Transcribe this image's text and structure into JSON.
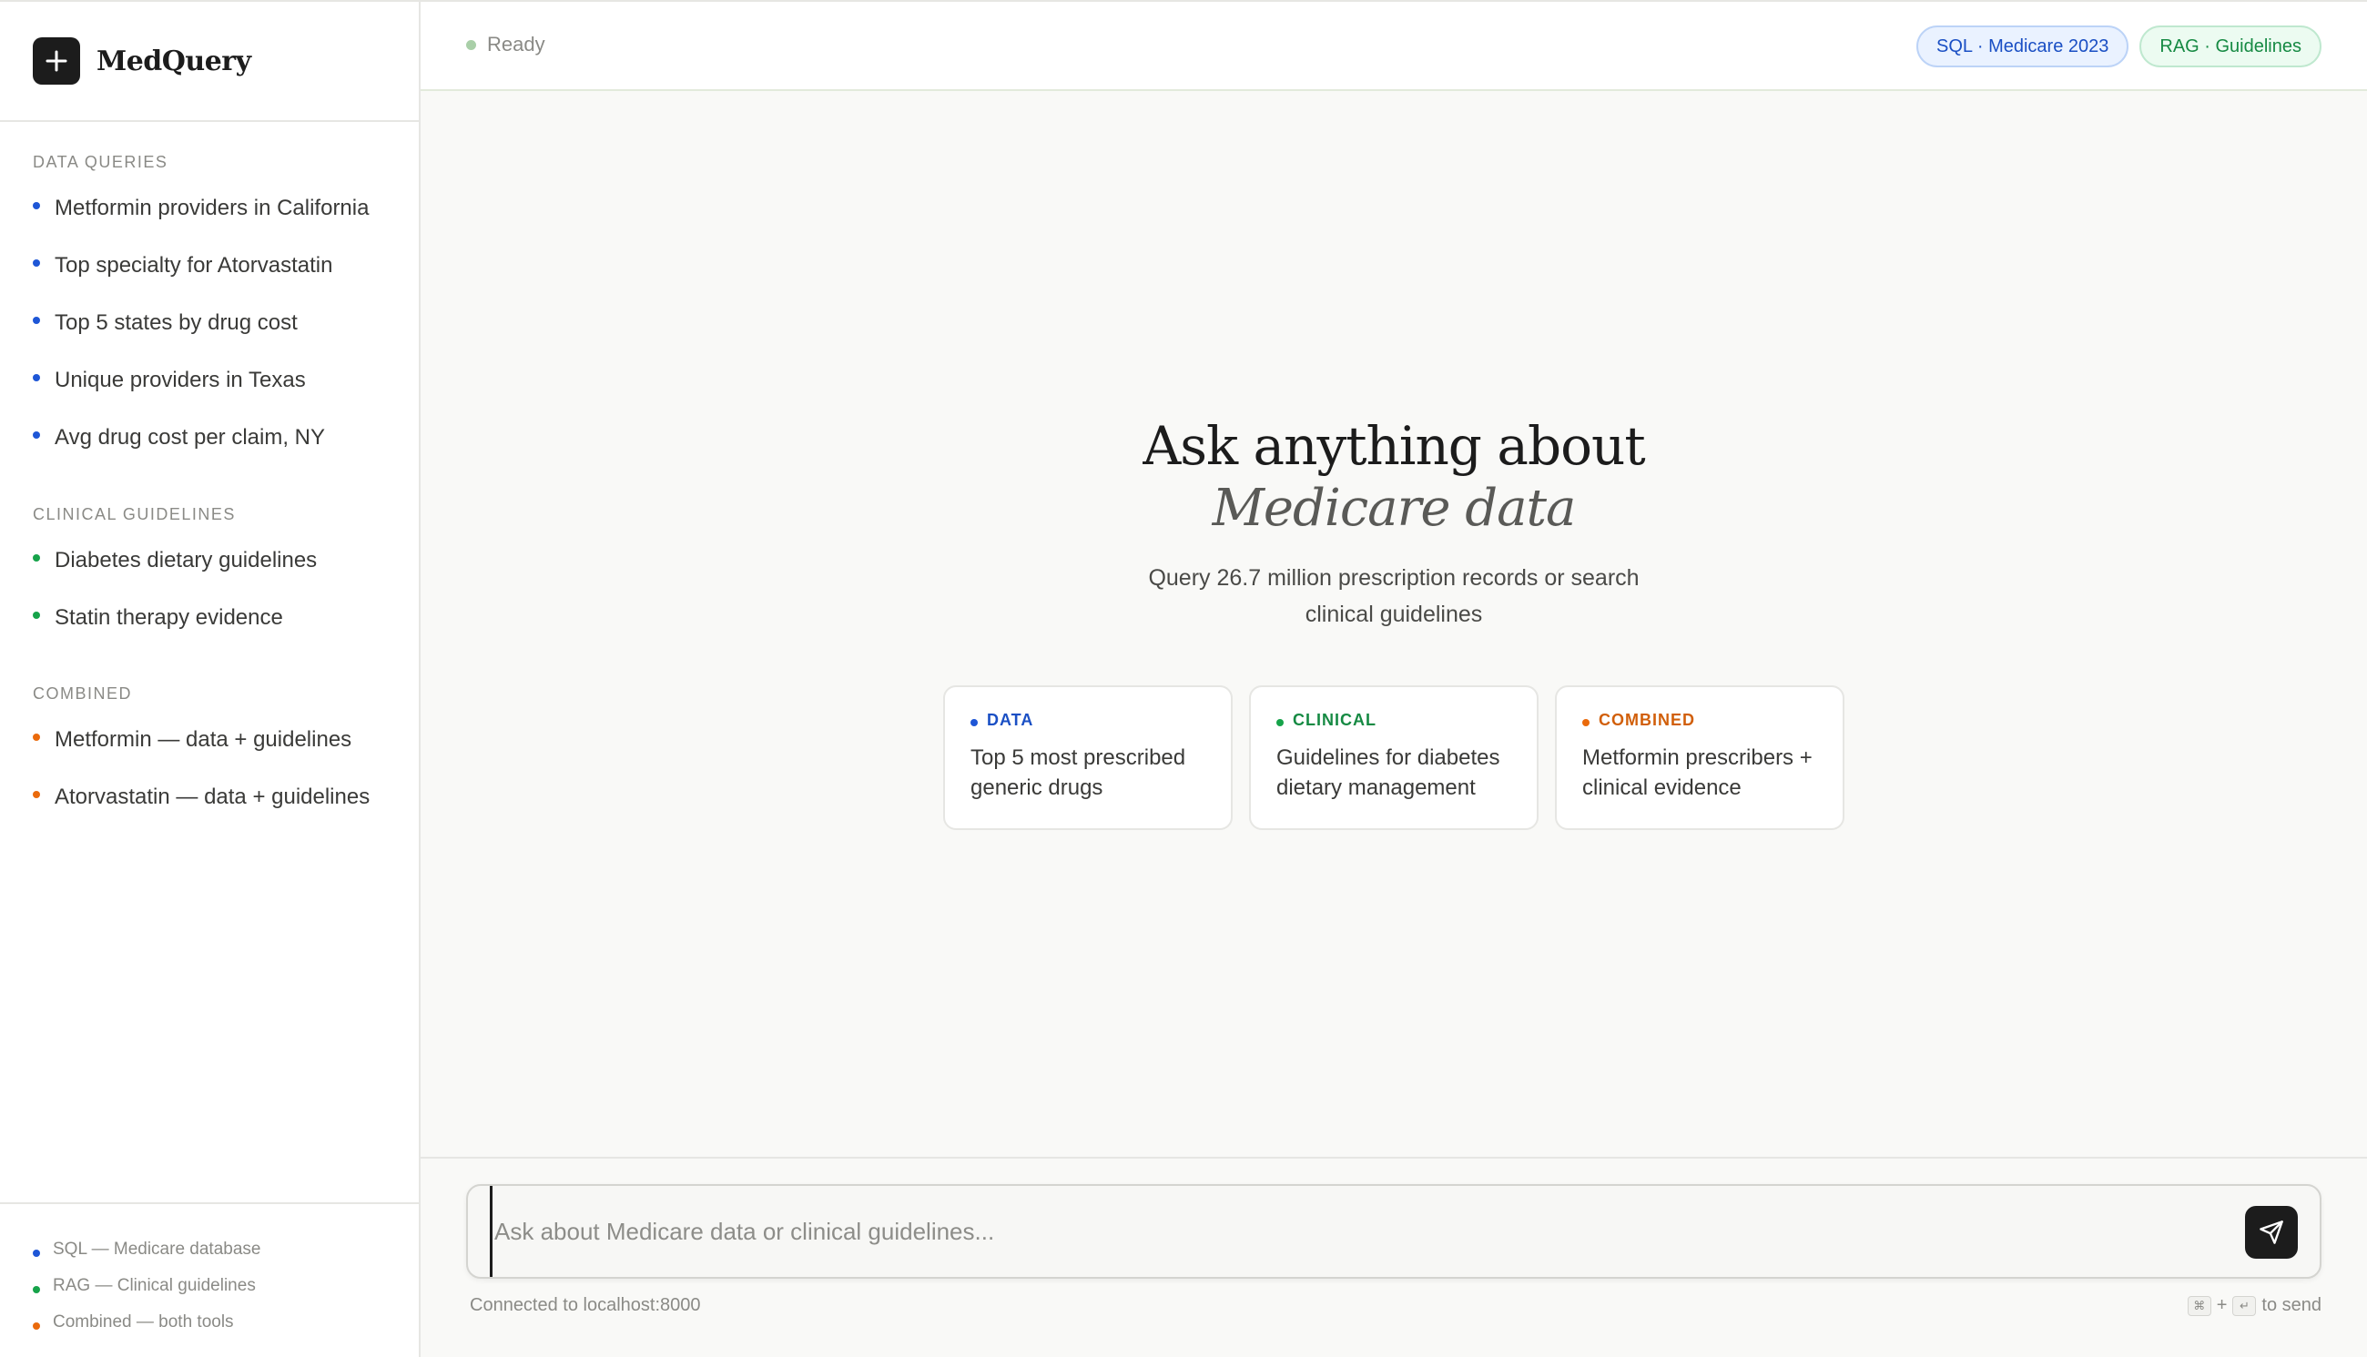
{
  "app": {
    "name": "MedQuery"
  },
  "sidebar": {
    "sections": [
      {
        "label": "DATA QUERIES",
        "color": "#1e56d6",
        "items": [
          "Metformin providers in California",
          "Top specialty for Atorvastatin",
          "Top 5 states by drug cost",
          "Unique providers in Texas",
          "Avg drug cost per claim, NY"
        ]
      },
      {
        "label": "CLINICAL GUIDELINES",
        "color": "#16a34a",
        "items": [
          "Diabetes dietary guidelines",
          "Statin therapy evidence"
        ]
      },
      {
        "label": "COMBINED",
        "color": "#ea6a0c",
        "items": [
          "Metformin — data + guidelines",
          "Atorvastatin — data + guidelines"
        ]
      }
    ],
    "legend": [
      "SQL — Medicare database",
      "RAG — Clinical guidelines",
      "Combined — both tools"
    ]
  },
  "topbar": {
    "status": "Ready",
    "pills": [
      "SQL · Medicare 2023",
      "RAG · Guidelines"
    ]
  },
  "hero": {
    "title_line1": "Ask anything about",
    "title_line2": "Medicare data",
    "subtitle": "Query 26.7 million prescription records or search clinical guidelines"
  },
  "cards": [
    {
      "tag": "DATA",
      "text": "Top 5 most prescribed generic drugs"
    },
    {
      "tag": "CLINICAL",
      "text": "Guidelines for diabetes dietary management"
    },
    {
      "tag": "COMBINED",
      "text": "Metformin prescribers + clinical evidence"
    }
  ],
  "composer": {
    "placeholder": "Ask about Medicare data or clinical guidelines...",
    "connection": "Connected to localhost:8000",
    "hint_key1": "⌘",
    "hint_plus": "+",
    "hint_key2": "↵",
    "hint_text": "to send"
  }
}
